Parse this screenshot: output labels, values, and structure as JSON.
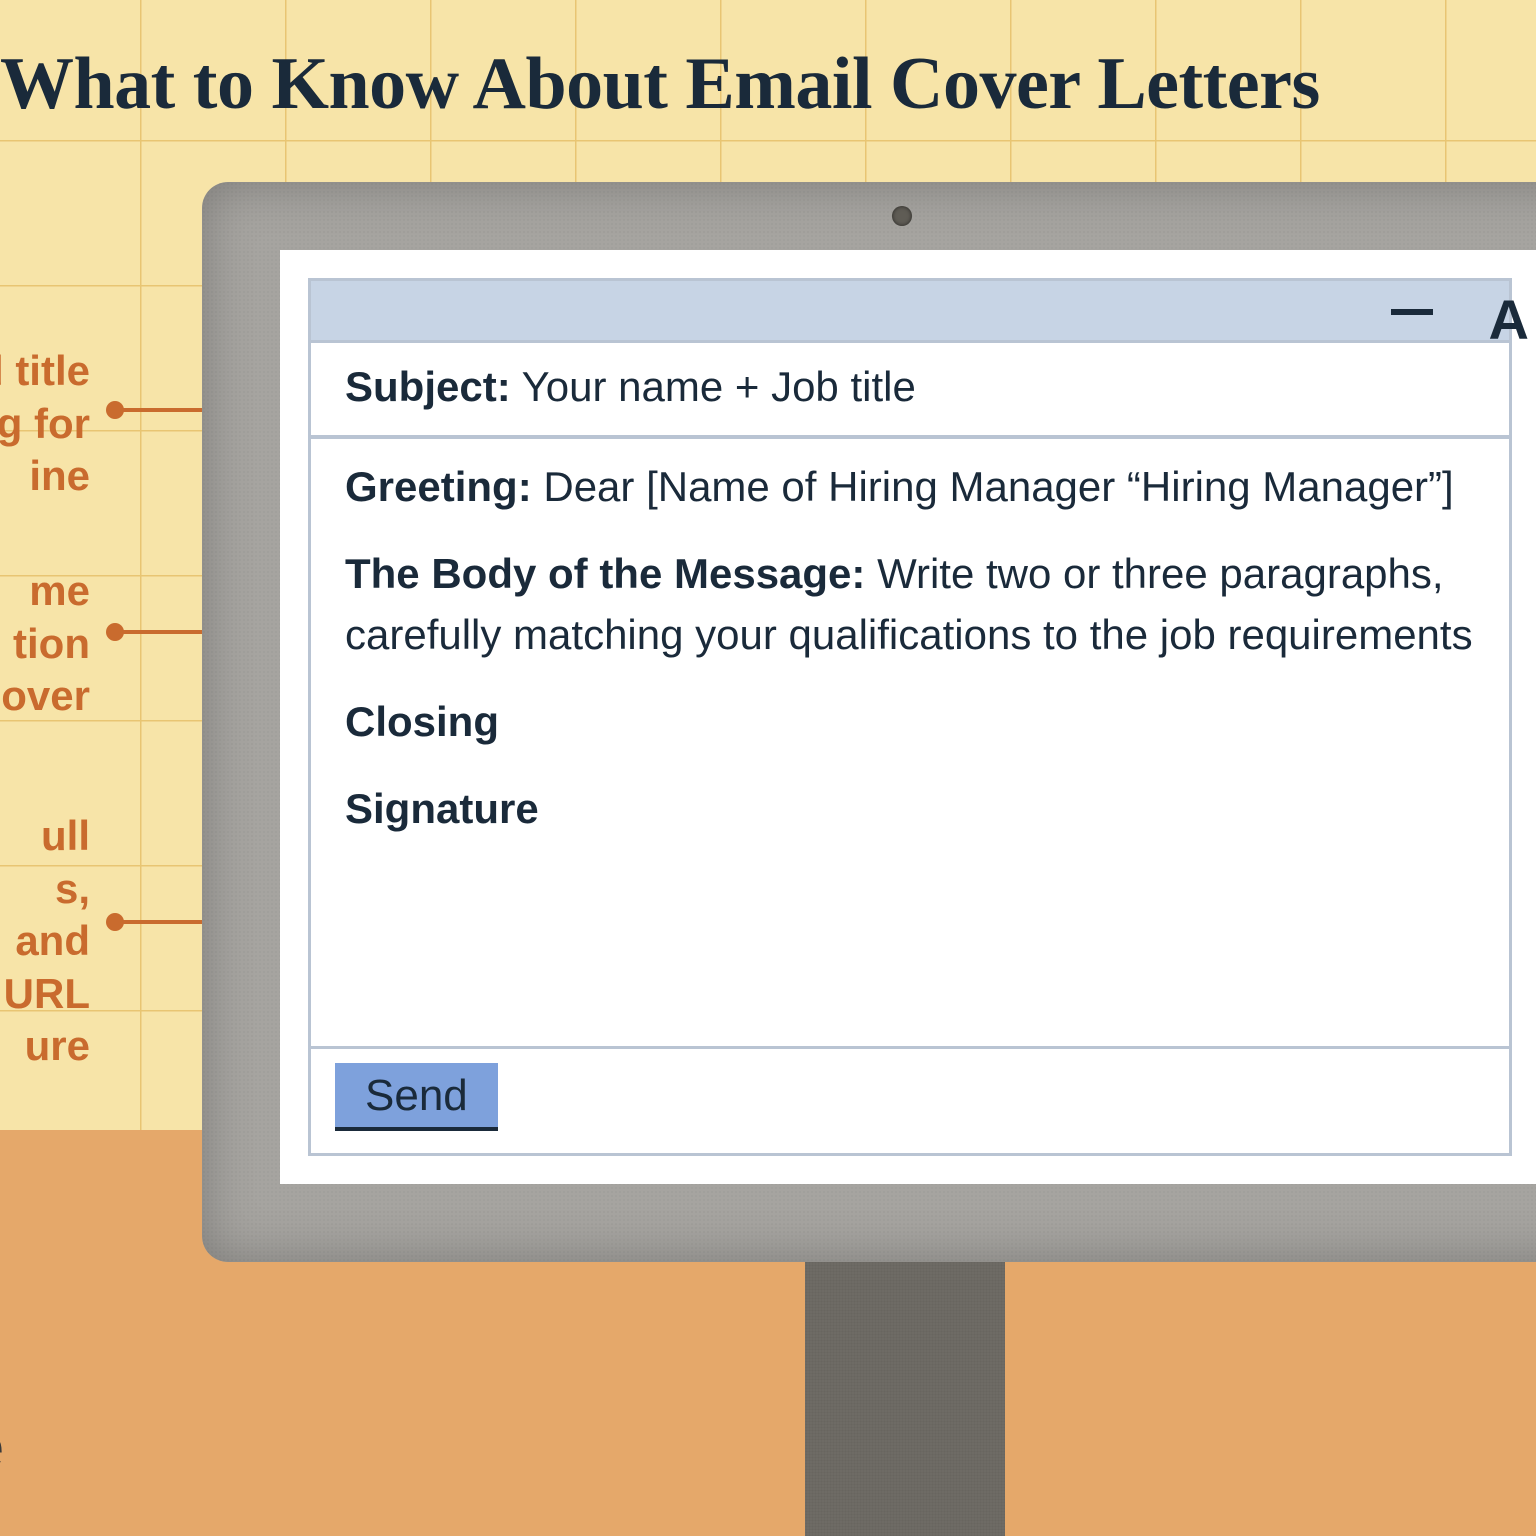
{
  "title": "What to Know About Email Cover Letters",
  "callouts": {
    "c1": "Include your name and title\nof the job you're applying for\nin the subject line",
    "c2": "Include the same\ninformation\nas a regular cover\nletter",
    "c3": "Include your full\nname, address,\nphone number, and\nLinkedIn profile URL\nwith your signature"
  },
  "email": {
    "subject_label": "Subject:",
    "subject_value": "Your name + Job title",
    "greeting_label": "Greeting:",
    "greeting_value": "Dear [Name of Hiring Manager “Hiring Manager”]",
    "body_label": "The Body of the Message:",
    "body_value_line1": "Write two or three paragraphs,",
    "body_value_line2": "carefully matching your qualifications to the job requirements",
    "closing_label": "Closing",
    "signature_label": "Signature",
    "send_label": "Send"
  },
  "brand_fragment": "ance"
}
